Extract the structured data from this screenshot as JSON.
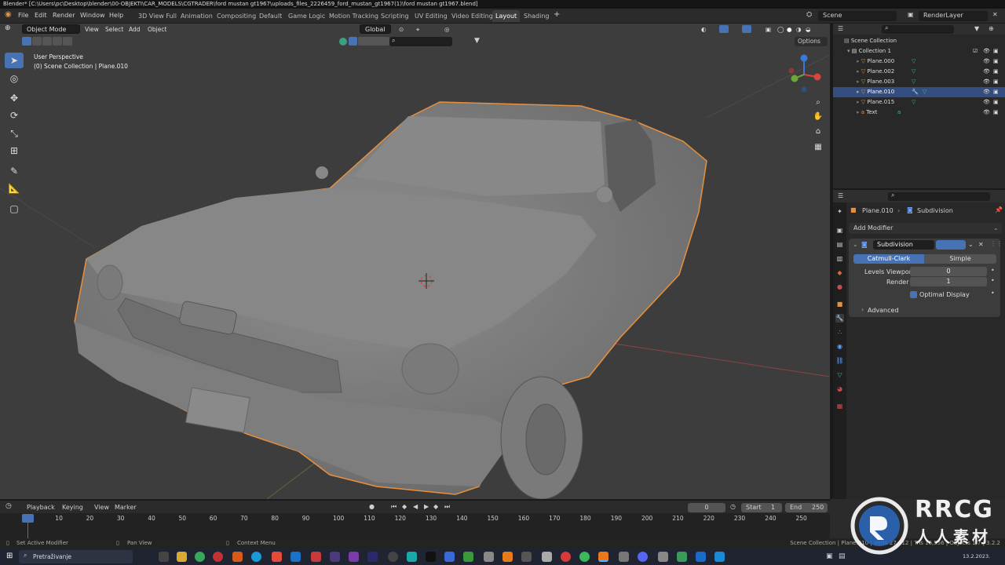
{
  "window_title": "Blender* [C:\\Users\\pc\\Desktop\\blender\\00-OBJEKTI\\CAR_MODELS\\CGTRADER\\ford mustan gt1967\\uploads_files_2226459_ford_mustan_gt1967(1)\\ford mustan gt1967.blend]",
  "menu": [
    "File",
    "Edit",
    "Render",
    "Window",
    "Help"
  ],
  "workspaces": [
    "3D View Full",
    "Animation",
    "Compositing",
    "Default",
    "Game Logic",
    "Motion Tracking",
    "Scripting",
    "UV Editing",
    "Video Editing",
    "Layout",
    "Shading"
  ],
  "active_workspace": "Layout",
  "scene": {
    "label": "Scene",
    "renderlayer": "RenderLayer"
  },
  "viewport": {
    "mode": "Object Mode",
    "menus": [
      "View",
      "Select",
      "Add",
      "Object"
    ],
    "transform": "Global",
    "options": "Options",
    "overlay_line1": "User Perspective",
    "overlay_line2": "(0) Scene Collection | Plane.010"
  },
  "outliner": {
    "root": "Scene Collection",
    "collection": "Collection 1",
    "items": [
      {
        "name": "Plane.000",
        "selected": false
      },
      {
        "name": "Plane.002",
        "selected": false
      },
      {
        "name": "Plane.003",
        "selected": false
      },
      {
        "name": "Plane.010",
        "selected": true
      },
      {
        "name": "Plane.015",
        "selected": false
      },
      {
        "name": "Text",
        "selected": false
      }
    ]
  },
  "properties": {
    "breadcrumb_object": "Plane.010",
    "breadcrumb_modifier": "Subdivision",
    "add_modifier": "Add Modifier",
    "modifier_name": "Subdivision",
    "tab_catmull": "Catmull-Clark",
    "tab_simple": "Simple",
    "levels_viewport_label": "Levels Viewport",
    "levels_viewport_value": "0",
    "render_label": "Render",
    "render_value": "1",
    "optimal_display": "Optimal Display",
    "advanced": "Advanced"
  },
  "timeline": {
    "menus": [
      "Playback",
      "Keying",
      "View",
      "Marker"
    ],
    "current_frame": "0",
    "start_label": "Start",
    "start_value": "1",
    "end_label": "End",
    "end_value": "250",
    "frames": [
      "0",
      "10",
      "20",
      "30",
      "40",
      "50",
      "60",
      "70",
      "80",
      "90",
      "100",
      "110",
      "120",
      "130",
      "140",
      "150",
      "160",
      "170",
      "180",
      "190",
      "200",
      "210",
      "220",
      "230",
      "240",
      "250"
    ]
  },
  "status": {
    "left1": "Set Active Modifier",
    "left2": "Pan View",
    "left3": "Context Menu",
    "right": "Scene Collection | Plane.010 | Verts 27,812 | Tris 16,556 | Objects 1/7 | 3.2.2"
  },
  "taskbar": {
    "search": "Pretraživanje",
    "date": "13.2.2023."
  },
  "watermark": {
    "big": "RRCG",
    "small": "人人素材"
  },
  "colors": {
    "accent": "#4772b3",
    "selection_outline": "#e8903c",
    "viewport_bg": "#3d3d3d"
  }
}
